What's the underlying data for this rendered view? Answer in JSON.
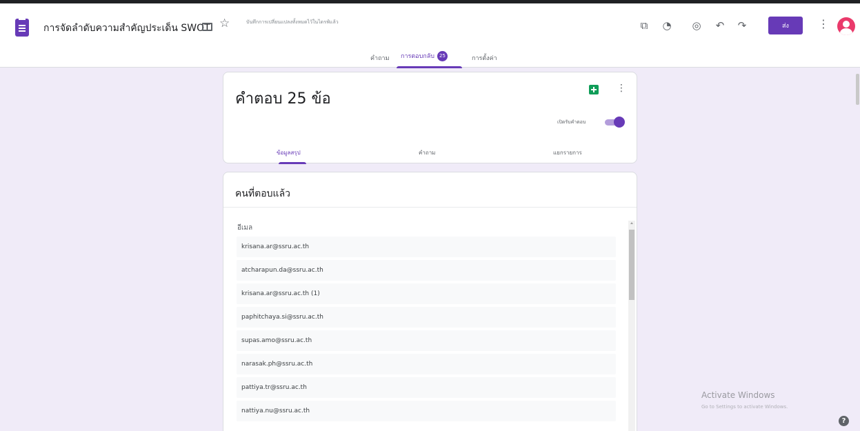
{
  "header": {
    "title": "การจัดลำดับความสำคัญประเด็น SWOT",
    "save_status": "บันทึกการเปลี่ยนแปลงทั้งหมดไว้ในไดรฟ์แล้ว",
    "send_label": "ส่ง",
    "icons": [
      "addon-icon",
      "palette-icon",
      "preview-eye-icon",
      "undo-icon",
      "redo-icon"
    ]
  },
  "tabs": [
    {
      "label": "คำถาม"
    },
    {
      "label": "การตอบกลับ",
      "badge": "25"
    },
    {
      "label": "การตั้งค่า"
    }
  ],
  "summary": {
    "title": "คำตอบ 25 ข้อ",
    "accept_label": "เปิดรับคำตอบ",
    "accepting": true,
    "subtabs": [
      {
        "label": "ข้อมูลสรุป"
      },
      {
        "label": "คำถาม"
      },
      {
        "label": "แยกรายการ"
      }
    ]
  },
  "respondents": {
    "title": "คนที่ตอบแล้ว",
    "column_header": "อีเมล",
    "emails": [
      "krisana.ar@ssru.ac.th",
      "atcharapun.da@ssru.ac.th",
      "krisana.ar@ssru.ac.th (1)",
      "paphitchaya.si@ssru.ac.th",
      "supas.amo@ssru.ac.th",
      "narasak.ph@ssru.ac.th",
      "pattiya.tr@ssru.ac.th",
      "nattiya.nu@ssru.ac.th"
    ]
  },
  "watermark": {
    "title": "Activate Windows",
    "subtitle": "Go to Settings to activate Windows."
  },
  "colors": {
    "accent": "#673ab7",
    "background": "#f0ebf8",
    "sheets": "#0f9d58",
    "avatar": "#ea3a6b"
  }
}
